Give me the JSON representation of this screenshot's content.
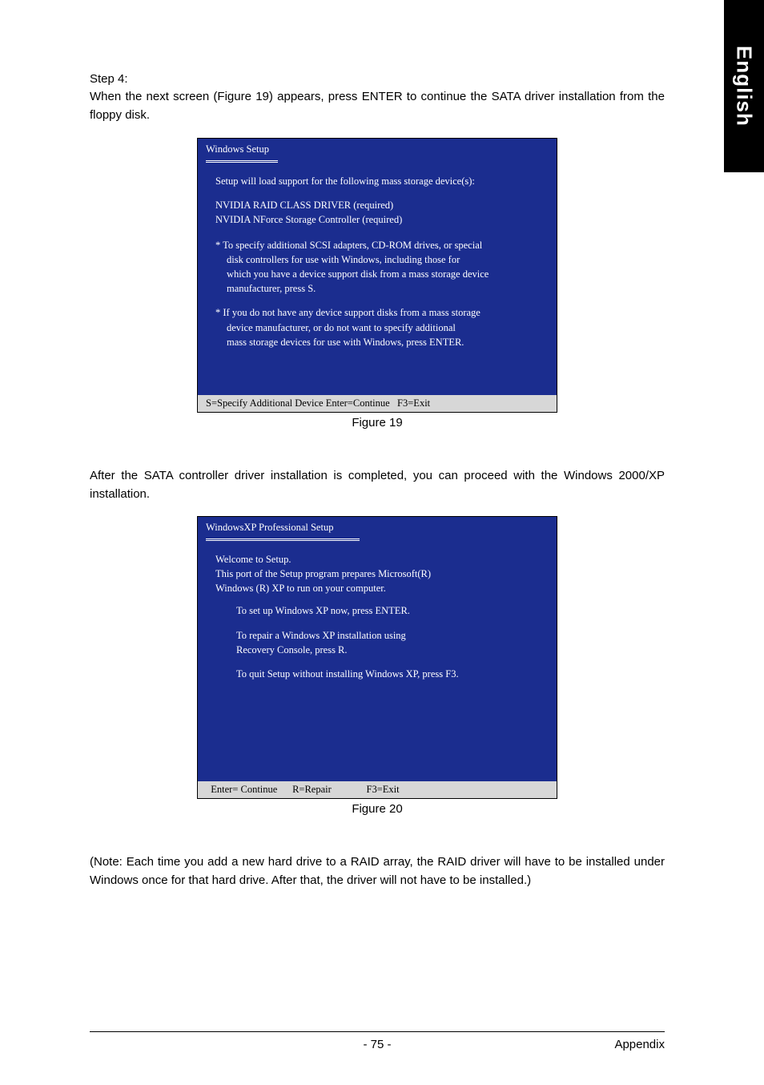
{
  "sideTab": "English",
  "step": {
    "label": "Step 4:"
  },
  "para1": "When the next screen (Figure 19) appears, press ENTER to continue the SATA driver installation from the floppy disk.",
  "fig19": {
    "title": "Windows Setup",
    "line_intro": "Setup will load support for the following mass storage device(s):",
    "drivers": [
      "NVIDIA RAID CLASS DRIVER (required)",
      "NVIDIA NForce Storage Controller (required)"
    ],
    "bullet1": {
      "l1": "* To specify additional SCSI adapters, CD-ROM drives, or special",
      "l2": "disk  controllers for use with Windows, including those for",
      "l3": "which you have a device support disk from a mass storage device",
      "l4": "manufacturer, press S."
    },
    "bullet2": {
      "l1": "* If you do not have any device support disks from a mass storage",
      "l2": "device manufacturer, or do not want to specify additional",
      "l3": "mass storage devices for use with Windows, press ENTER."
    },
    "footer": "S=Specify Additional Device Enter=Continue   F3=Exit",
    "caption": "Figure 19"
  },
  "para2": "After the SATA controller driver installation is completed, you can proceed with the Windows 2000/XP installation.",
  "fig20": {
    "title": "WindowsXP Professional  Setup",
    "welcome": "Welcome to Setup.",
    "desc1": "This port of the Setup program prepares Microsoft(R)",
    "desc2": "Windows (R) XP  to run on your computer.",
    "opt1": "To set up Windows XP now, press ENTER.",
    "opt2a": "To repair a Windows XP installation using",
    "opt2b": "Recovery Console, press R.",
    "opt3": "To quit Setup without installing Windows XP, press F3.",
    "footer": "  Enter= Continue      R=Repair              F3=Exit",
    "caption": "Figure 20"
  },
  "note": "(Note: Each time you add a new hard drive to a RAID array, the RAID driver will have to be installed under Windows once for that hard drive. After that, the driver will not have to be installed.)",
  "footer": {
    "page": "- 75 -",
    "section": "Appendix"
  }
}
